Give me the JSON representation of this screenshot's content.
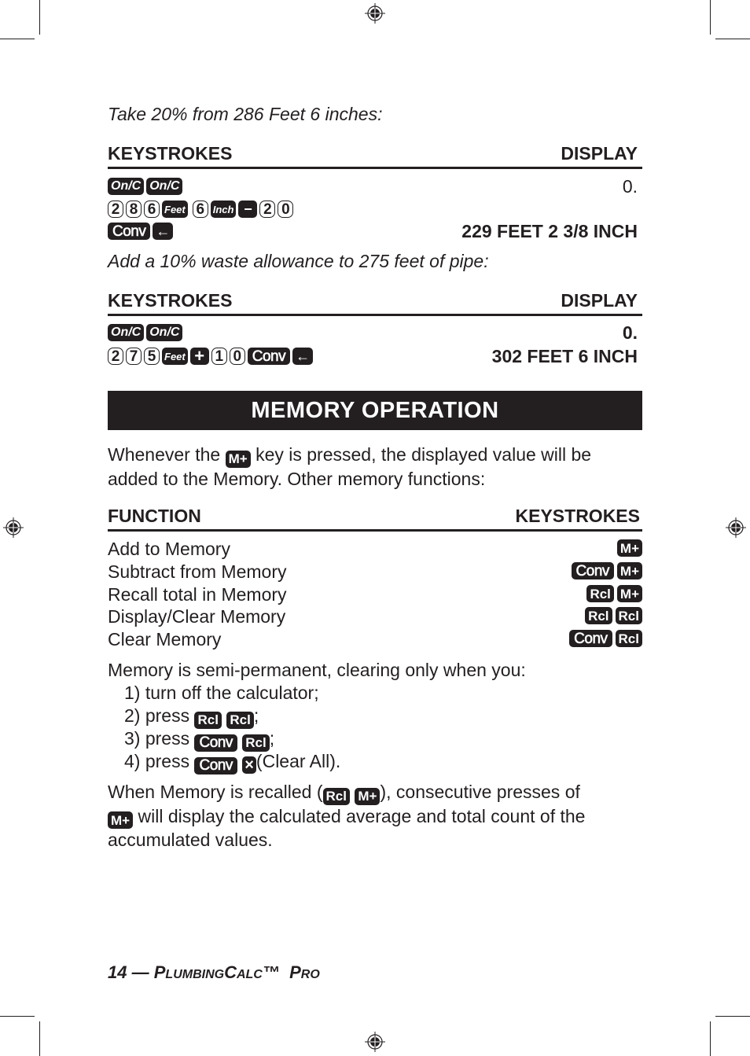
{
  "example1": {
    "intro": "Take 20% from 286 Feet 6 inches:",
    "header_left": "KEYSTROKES",
    "header_right": "DISPLAY",
    "rows": [
      {
        "keys": [
          "On/C",
          "On/C"
        ],
        "display": "0."
      },
      {
        "keys": [
          "2",
          "8",
          "6",
          "Feet",
          "6",
          "Inch",
          "−",
          "2",
          "0"
        ],
        "display": ""
      },
      {
        "keys": [
          "Conv",
          "←"
        ],
        "display": "229 FEET 2 3/8 INCH"
      }
    ]
  },
  "example2": {
    "intro": "Add a 10% waste allowance to 275 feet of pipe:",
    "header_left": "KEYSTROKES",
    "header_right": "DISPLAY",
    "rows": [
      {
        "keys": [
          "On/C",
          "On/C"
        ],
        "display": "0."
      },
      {
        "keys": [
          "2",
          "7",
          "5",
          "Feet",
          "+",
          "1",
          "0",
          "Conv",
          "←"
        ],
        "display": "302 FEET 6 INCH"
      }
    ]
  },
  "memory": {
    "title": "MEMORY OPERATION",
    "intro_before": "Whenever the",
    "intro_key": "M+",
    "intro_after_line1": "key is pressed, the displayed value will be",
    "intro_line2": "added to the Memory. Other memory functions:",
    "table_header_left": "FUNCTION",
    "table_header_right": "KEYSTROKES",
    "functions": [
      {
        "label": "Add to Memory",
        "keys": [
          "M+"
        ]
      },
      {
        "label": "Subtract from Memory",
        "keys": [
          "Conv",
          "M+"
        ]
      },
      {
        "label": "Recall total in Memory",
        "keys": [
          "Rcl",
          "M+"
        ]
      },
      {
        "label": "Display/Clear Memory",
        "keys": [
          "Rcl",
          "Rcl"
        ]
      },
      {
        "label": "Clear Memory",
        "keys": [
          "Conv",
          "Rcl"
        ]
      }
    ],
    "semi_permanent_intro": "Memory is semi-permanent, clearing only when you:",
    "clear_conditions": [
      {
        "prefix": "1) turn off the calculator;",
        "keys": [],
        "suffix": ""
      },
      {
        "prefix": "2) press",
        "keys": [
          "Rcl",
          "Rcl"
        ],
        "suffix": ";"
      },
      {
        "prefix": "3) press",
        "keys": [
          "Conv",
          "Rcl"
        ],
        "suffix": ";"
      },
      {
        "prefix": "4) press",
        "keys": [
          "Conv",
          "×"
        ],
        "suffix": "(Clear All)."
      }
    ],
    "recall_p_before": "When Memory is recalled (",
    "recall_p_keys": [
      "Rcl",
      "M+"
    ],
    "recall_p_after": "), consecutive presses of",
    "recall_p_key2": "M+",
    "recall_p_line2": "will display the calculated average and total count of the",
    "recall_p_line3": "accumulated values."
  },
  "footer": {
    "page_number": "14",
    "dash": "—",
    "brand_p": "P",
    "brand_lumbing": "LUMBING",
    "brand_c": "C",
    "brand_alc": "ALC",
    "tm": "™",
    "brand_pr": "P",
    "brand_ro": "RO"
  }
}
